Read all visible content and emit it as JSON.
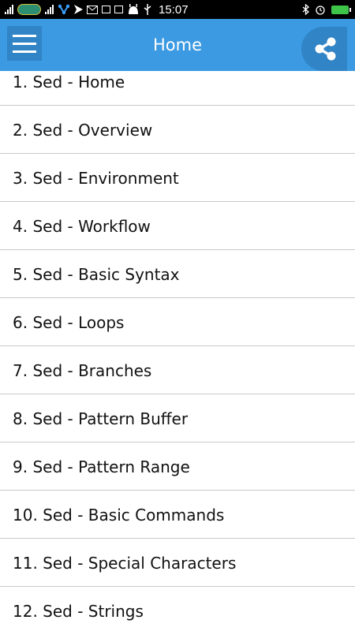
{
  "status_bar": {
    "time": "15:07",
    "icons": [
      "signal-icon",
      "carrier-logo-icon",
      "signal-icon",
      "network-icon",
      "send-icon",
      "gmail-icon",
      "facebook-icon",
      "photo-icon",
      "android-icon",
      "usb-icon",
      "bluetooth-icon",
      "alarm-icon",
      "battery-charging-icon"
    ]
  },
  "app_bar": {
    "title": "Home",
    "menu_icon": "hamburger-menu-icon",
    "share_icon": "share-icon",
    "color": "#3b9ae1"
  },
  "list": {
    "items": [
      {
        "label": "1. Sed - Home"
      },
      {
        "label": "2. Sed - Overview"
      },
      {
        "label": "3. Sed - Environment"
      },
      {
        "label": "4. Sed - Workflow"
      },
      {
        "label": "5. Sed - Basic Syntax"
      },
      {
        "label": "6. Sed - Loops"
      },
      {
        "label": "7. Sed - Branches"
      },
      {
        "label": "8. Sed - Pattern Buffer"
      },
      {
        "label": "9. Sed - Pattern Range"
      },
      {
        "label": "10. Sed - Basic Commands"
      },
      {
        "label": "11. Sed - Special Characters"
      },
      {
        "label": "12. Sed - Strings"
      }
    ]
  }
}
